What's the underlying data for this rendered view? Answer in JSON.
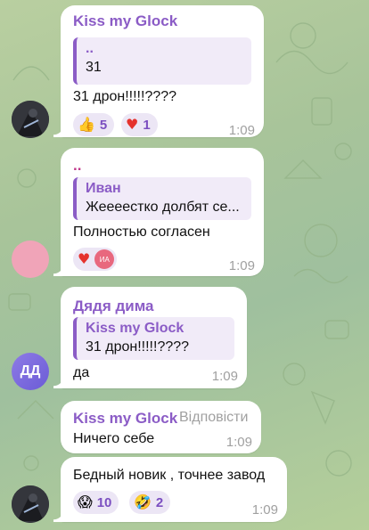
{
  "messages": [
    {
      "sender": "Kiss my Glock",
      "sender_color": "#8b5cc6",
      "quote": {
        "name": "..",
        "text": "31"
      },
      "text": "31 дрон!!!!!????",
      "reactions": [
        {
          "icon": "thumbs-up-icon",
          "emoji": "👍",
          "count": "5"
        },
        {
          "icon": "heart-icon",
          "emoji": "♥",
          "count": "1"
        }
      ],
      "time": "1:09"
    },
    {
      "sender": "..",
      "sender_color": "#c0398b",
      "quote": {
        "name": "Иван",
        "text": "Жеееестко долбят се..."
      },
      "text": "Полностью согласен",
      "reactions": [
        {
          "icon": "heart-icon",
          "emoji": "♥"
        }
      ],
      "reactor_initials": "ИА",
      "time": "1:09"
    },
    {
      "sender": "Дядя дима",
      "sender_color": "#8b5cc6",
      "quote": {
        "name": "Kiss my Glock",
        "text": "31 дрон!!!!!????"
      },
      "text": "да",
      "avatar_initials": "ДД",
      "time": "1:09"
    },
    {
      "sender": "Kiss my Glock",
      "sender_color": "#8b5cc6",
      "reply_label": "Відповісти",
      "text": "Ничего себе",
      "time": "1:09"
    },
    {
      "text": "Бедный новик , точнее завод",
      "reactions": [
        {
          "icon": "scream-face-icon",
          "emoji": "😱",
          "count": "10"
        },
        {
          "icon": "rofl-face-icon",
          "emoji": "🤣",
          "count": "2"
        }
      ],
      "time": "1:09"
    }
  ]
}
